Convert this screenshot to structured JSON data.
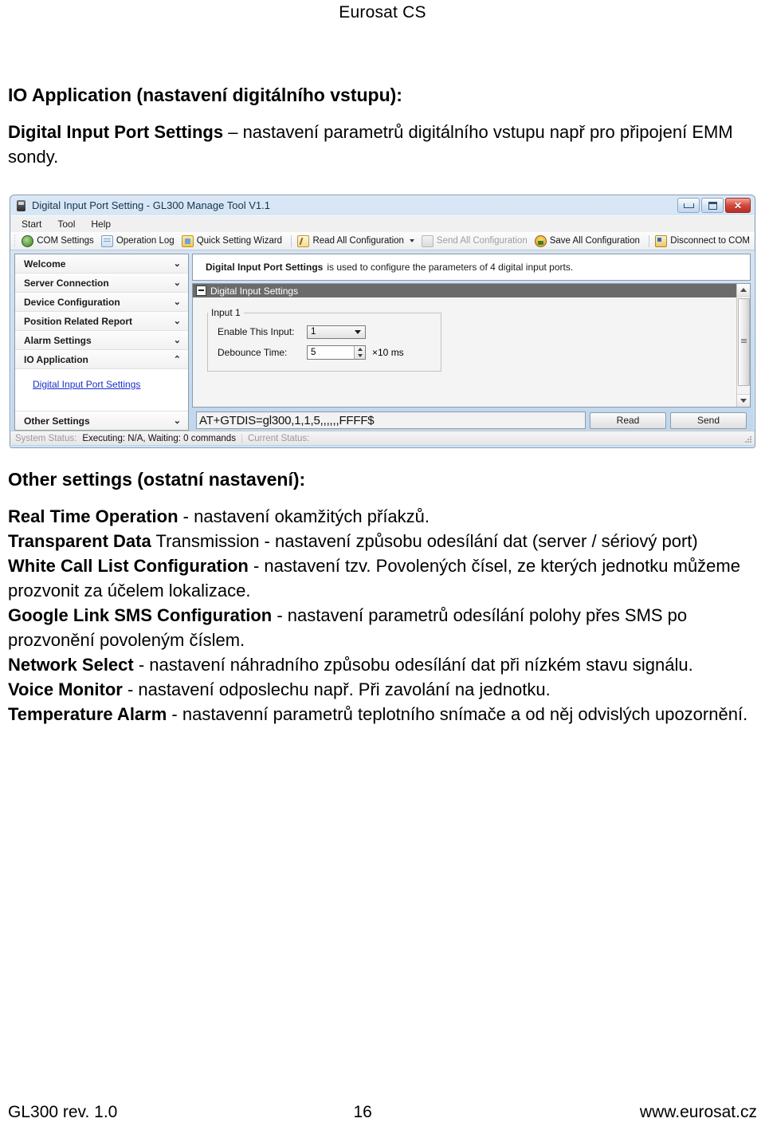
{
  "document": {
    "header_title": "Eurosat CS",
    "section_heading": "IO Application (nastavení digitálního vstupu):",
    "intro_bold": "Digital Input Port Settings",
    "intro_rest": " – nastavení parametrů digitálního vstupu např pro připojení EMM sondy.",
    "other_heading": "Other settings (ostatní nastavení):",
    "items": [
      {
        "bold": "Real Time Operation",
        "rest": " - nastavení okamžitých příakzů."
      },
      {
        "bold": "Transparent Data",
        "rest": " Transmission - nastavení způsobu odesílání dat (server / sériový port)"
      },
      {
        "bold": "White Call List Configuration",
        "rest": " - nastavení tzv. Povolených čísel, ze kterých jednotku můžeme prozvonit za účelem lokalizace."
      },
      {
        "bold": "Google Link SMS Configuration",
        "rest": " - nastavení parametrů odesílání polohy přes SMS po prozvonění povoleným číslem."
      },
      {
        "bold": "Network Select",
        "rest": " - nastavení náhradního způsobu odesílání dat při nízkém stavu signálu."
      },
      {
        "bold": "Voice Monitor",
        "rest": " - nastavení odposlechu např. Při zavolání na jednotku."
      },
      {
        "bold": "Temperature Alarm",
        "rest": " - nastavenní parametrů teplotního snímače a od něj odvislých upozornění."
      }
    ],
    "footer": {
      "left": "GL300 rev. 1.0",
      "page": "16",
      "right": "www.eurosat.cz"
    }
  },
  "app": {
    "window_title": "Digital Input Port Setting - GL300 Manage Tool V1.1",
    "window_buttons": {
      "minimize": "minimize",
      "maximize": "maximize",
      "close": "✕"
    },
    "menu": [
      "Start",
      "Tool",
      "Help"
    ],
    "toolbar": [
      {
        "label": "COM Settings",
        "icon": "com-settings-icon",
        "disabled": false,
        "dropdown": false
      },
      {
        "label": "Operation Log",
        "icon": "operation-log-icon",
        "disabled": false,
        "dropdown": false
      },
      {
        "label": "Quick Setting Wizard",
        "icon": "quick-setting-wizard-icon",
        "disabled": false,
        "dropdown": false
      },
      {
        "label": "Read All Configuration",
        "icon": "read-all-configuration-icon",
        "disabled": false,
        "dropdown": true
      },
      {
        "label": "Send All Configuration",
        "icon": "send-all-configuration-icon",
        "disabled": true,
        "dropdown": false
      },
      {
        "label": "Save All Configuration",
        "icon": "save-all-configuration-icon",
        "disabled": false,
        "dropdown": false
      },
      {
        "label": "Disconnect to COM",
        "icon": "disconnect-to-com-icon",
        "disabled": false,
        "dropdown": false
      }
    ],
    "sidebar": {
      "items": [
        {
          "label": "Welcome",
          "chevron": "⌄",
          "expanded": false
        },
        {
          "label": "Server Connection",
          "chevron": "⌄",
          "expanded": false
        },
        {
          "label": "Device Configuration",
          "chevron": "⌄",
          "expanded": false
        },
        {
          "label": "Position Related Report",
          "chevron": "⌄",
          "expanded": false
        },
        {
          "label": "Alarm Settings",
          "chevron": "⌄",
          "expanded": false
        },
        {
          "label": "IO Application",
          "chevron": "⌃",
          "expanded": true
        }
      ],
      "active_link": "Digital Input Port Settings",
      "last_item": {
        "label": "Other Settings",
        "chevron": "⌄",
        "expanded": false
      }
    },
    "description": {
      "bold": "Digital Input Port Settings",
      "rest": "is used to configure the parameters of 4 digital input ports."
    },
    "group": {
      "title": "Digital Input Settings",
      "legend": "Input 1",
      "fields": [
        {
          "label": "Enable This Input:",
          "value": "1",
          "type": "combo"
        },
        {
          "label": "Debounce Time:",
          "value": "5",
          "type": "spinner",
          "unit": "×10 ms"
        }
      ]
    },
    "command": {
      "text": "AT+GTDIS=gl300,1,1,5,,,,,,FFFF$",
      "read_label": "Read",
      "send_label": "Send"
    },
    "status": {
      "system_label": "System Status:",
      "system_value": "Executing: N/A, Waiting: 0 commands",
      "current_label": "Current Status:"
    }
  }
}
